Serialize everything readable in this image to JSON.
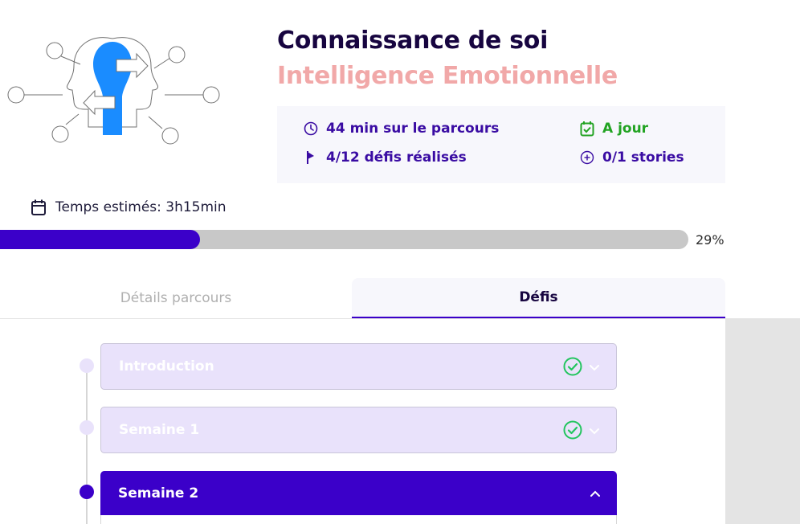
{
  "course": {
    "title": "Connaissance de soi",
    "subtitle": "Intelligence Emotionnelle",
    "illustration_icon": "head-profiles-icon"
  },
  "stats": {
    "time_on_path": "44 min sur le parcours",
    "challenges_done": "4/12 défis réalisés",
    "status": "A jour",
    "stories": "0/1 stories"
  },
  "estimate": {
    "label": "Temps estimés: 3h15min"
  },
  "progress": {
    "percent": 29,
    "label": "29%"
  },
  "tabs": {
    "details": "Détails parcours",
    "defis": "Défis"
  },
  "weeks": [
    {
      "label": "Introduction",
      "completed": true,
      "expanded": false
    },
    {
      "label": "Semaine 1",
      "completed": true,
      "expanded": false
    },
    {
      "label": "Semaine 2",
      "completed": false,
      "expanded": true
    }
  ],
  "colors": {
    "primary": "#3b00c9",
    "title": "#170540",
    "subtitle": "#f1a8a8",
    "success": "#22a322",
    "completed_bg": "#e9e2fb"
  }
}
